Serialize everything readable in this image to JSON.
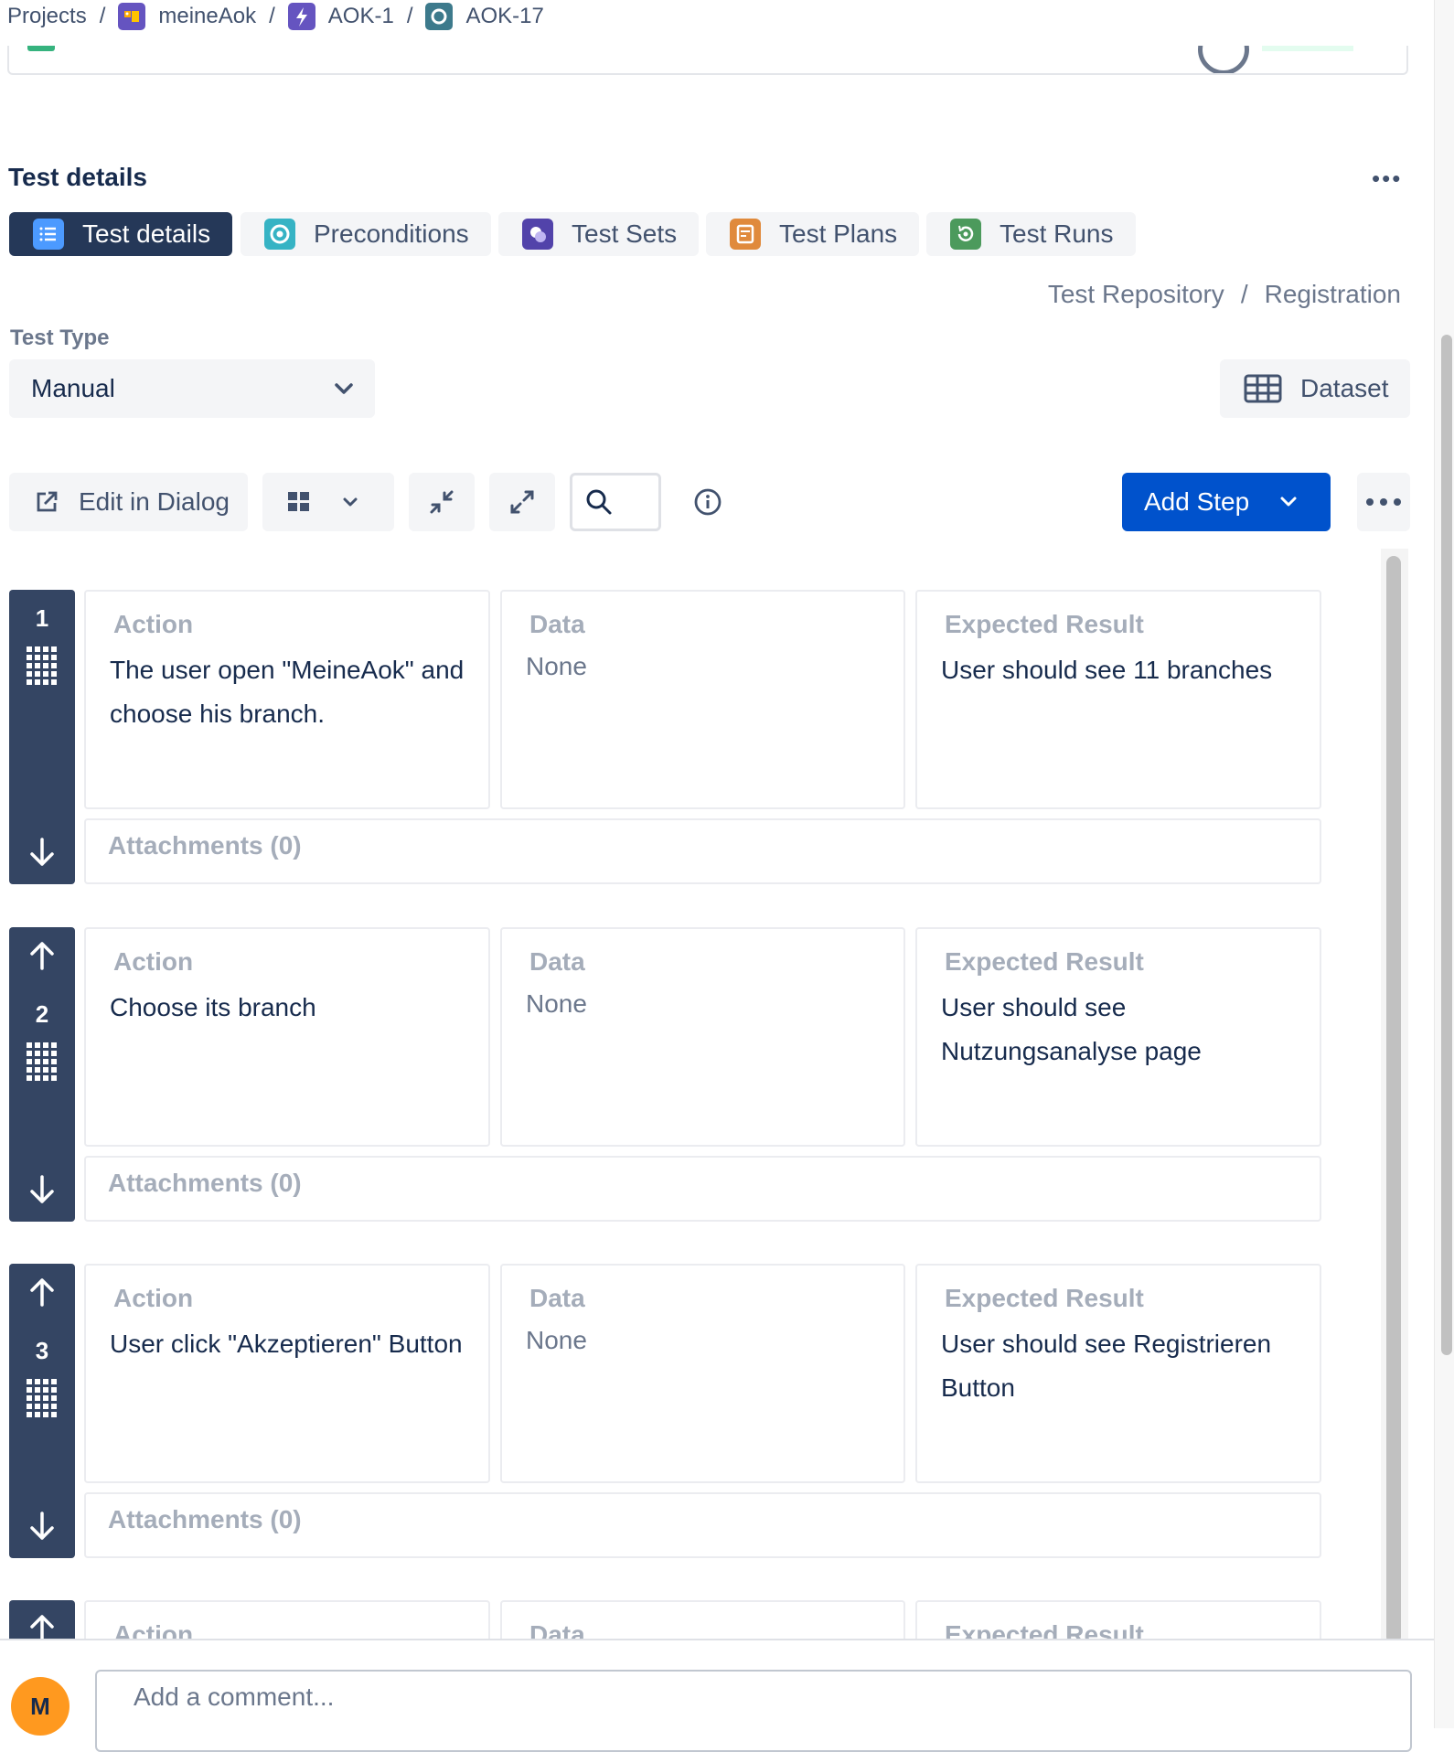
{
  "breadcrumb": {
    "projects": "Projects",
    "items": [
      {
        "label": "meineAok",
        "icon": "project-avatar-icon",
        "color": "#6554c0"
      },
      {
        "label": "AOK-1",
        "icon": "epic-lightning-icon",
        "color": "#6554c0"
      },
      {
        "label": "AOK-17",
        "icon": "test-issue-icon",
        "color": "#3d7a8c"
      }
    ]
  },
  "section": {
    "title": "Test details",
    "more": "•••"
  },
  "tabs": [
    {
      "label": "Test details",
      "icon": "list-icon",
      "active": true
    },
    {
      "label": "Preconditions",
      "icon": "precondition-icon",
      "active": false
    },
    {
      "label": "Test Sets",
      "icon": "test-sets-icon",
      "active": false
    },
    {
      "label": "Test Plans",
      "icon": "test-plans-icon",
      "active": false
    },
    {
      "label": "Test Runs",
      "icon": "test-runs-icon",
      "active": false
    }
  ],
  "repository_path": {
    "root": "Test Repository",
    "separator": "/",
    "folder": "Registration"
  },
  "test_type": {
    "label": "Test Type",
    "value": "Manual"
  },
  "dataset_button": "Dataset",
  "toolbar": {
    "edit_in_dialog": "Edit in Dialog",
    "add_step": "Add Step"
  },
  "step_headers": {
    "action": "Action",
    "data": "Data",
    "expected": "Expected Result"
  },
  "steps": [
    {
      "number": "1",
      "action": "The user open \"MeineAok\" and choose his branch.",
      "data": "None",
      "expected": "User should see 11 branches",
      "attachments": "Attachments (0)"
    },
    {
      "number": "2",
      "action": "Choose its branch",
      "data": "None",
      "expected": "User should see Nutzungsanalyse page",
      "attachments": "Attachments (0)"
    },
    {
      "number": "3",
      "action": "User click \"Akzeptieren\" Button",
      "data": "None",
      "expected": "User should see Registrieren Button",
      "attachments": "Attachments (0)"
    }
  ],
  "comment": {
    "avatar_initial": "M",
    "placeholder": "Add a comment..."
  },
  "colors": {
    "primary": "#0052cc",
    "rail": "#344563",
    "active_tab": "#253858",
    "avatar": "#ff991f"
  }
}
